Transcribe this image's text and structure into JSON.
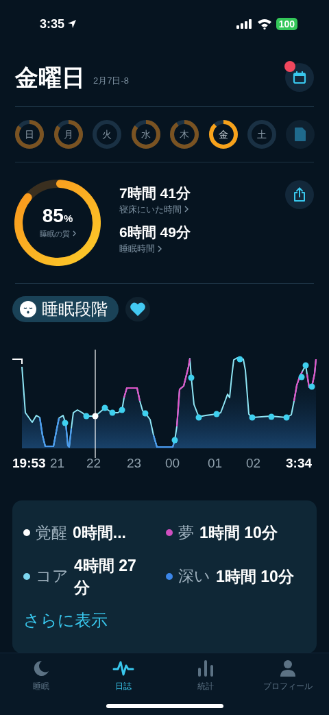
{
  "status_bar": {
    "time": "3:35",
    "battery": "100"
  },
  "header": {
    "title": "金曜日",
    "date": "2月7日-8",
    "calendar_badge": true
  },
  "days": [
    {
      "label": "日",
      "level": 0.85,
      "selected": false
    },
    {
      "label": "月",
      "level": 0.85,
      "selected": false
    },
    {
      "label": "火",
      "level": 0,
      "selected": false
    },
    {
      "label": "水",
      "level": 0.85,
      "selected": false
    },
    {
      "label": "木",
      "level": 0.9,
      "selected": false
    },
    {
      "label": "金",
      "level": 0.88,
      "selected": true
    },
    {
      "label": "土",
      "level": 0,
      "selected": false
    }
  ],
  "summary": {
    "quality": {
      "value": "85",
      "unit": "%",
      "label": "睡眠の質",
      "level": 0.85
    },
    "stats": [
      {
        "value": "7時間 41分",
        "label": "寝床にいた時間"
      },
      {
        "value": "6時間 49分",
        "label": "睡眠時間"
      }
    ]
  },
  "section": {
    "title": "睡眠段階",
    "favorite": true
  },
  "time_labels": [
    {
      "text": "19:53",
      "kind": "edge"
    },
    {
      "text": "21",
      "kind": "hour"
    },
    {
      "text": "22",
      "kind": "hour"
    },
    {
      "text": "23",
      "kind": "hour"
    },
    {
      "text": "00",
      "kind": "hour"
    },
    {
      "text": "01",
      "kind": "hour"
    },
    {
      "text": "02",
      "kind": "hour"
    },
    {
      "text": "3:34",
      "kind": "edge"
    }
  ],
  "legend": [
    {
      "name": "覚醒",
      "value": "0時間...",
      "color": "#ffffff"
    },
    {
      "name": "夢",
      "value": "1時間 10分",
      "color": "#d04fc0"
    },
    {
      "name": "コア",
      "value": "4時間 27分",
      "color": "#7dd6f0"
    },
    {
      "name": "深い",
      "value": "1時間 10分",
      "color": "#3b86e8"
    }
  ],
  "more_link": "さらに表示",
  "tab_bar": [
    {
      "label": "睡眠",
      "kind": "sleep",
      "selected": false
    },
    {
      "label": "日誌",
      "kind": "journal",
      "selected": true
    },
    {
      "label": "統計",
      "kind": "stats",
      "selected": false
    },
    {
      "label": "プロフィール",
      "kind": "profile",
      "selected": false
    }
  ]
}
